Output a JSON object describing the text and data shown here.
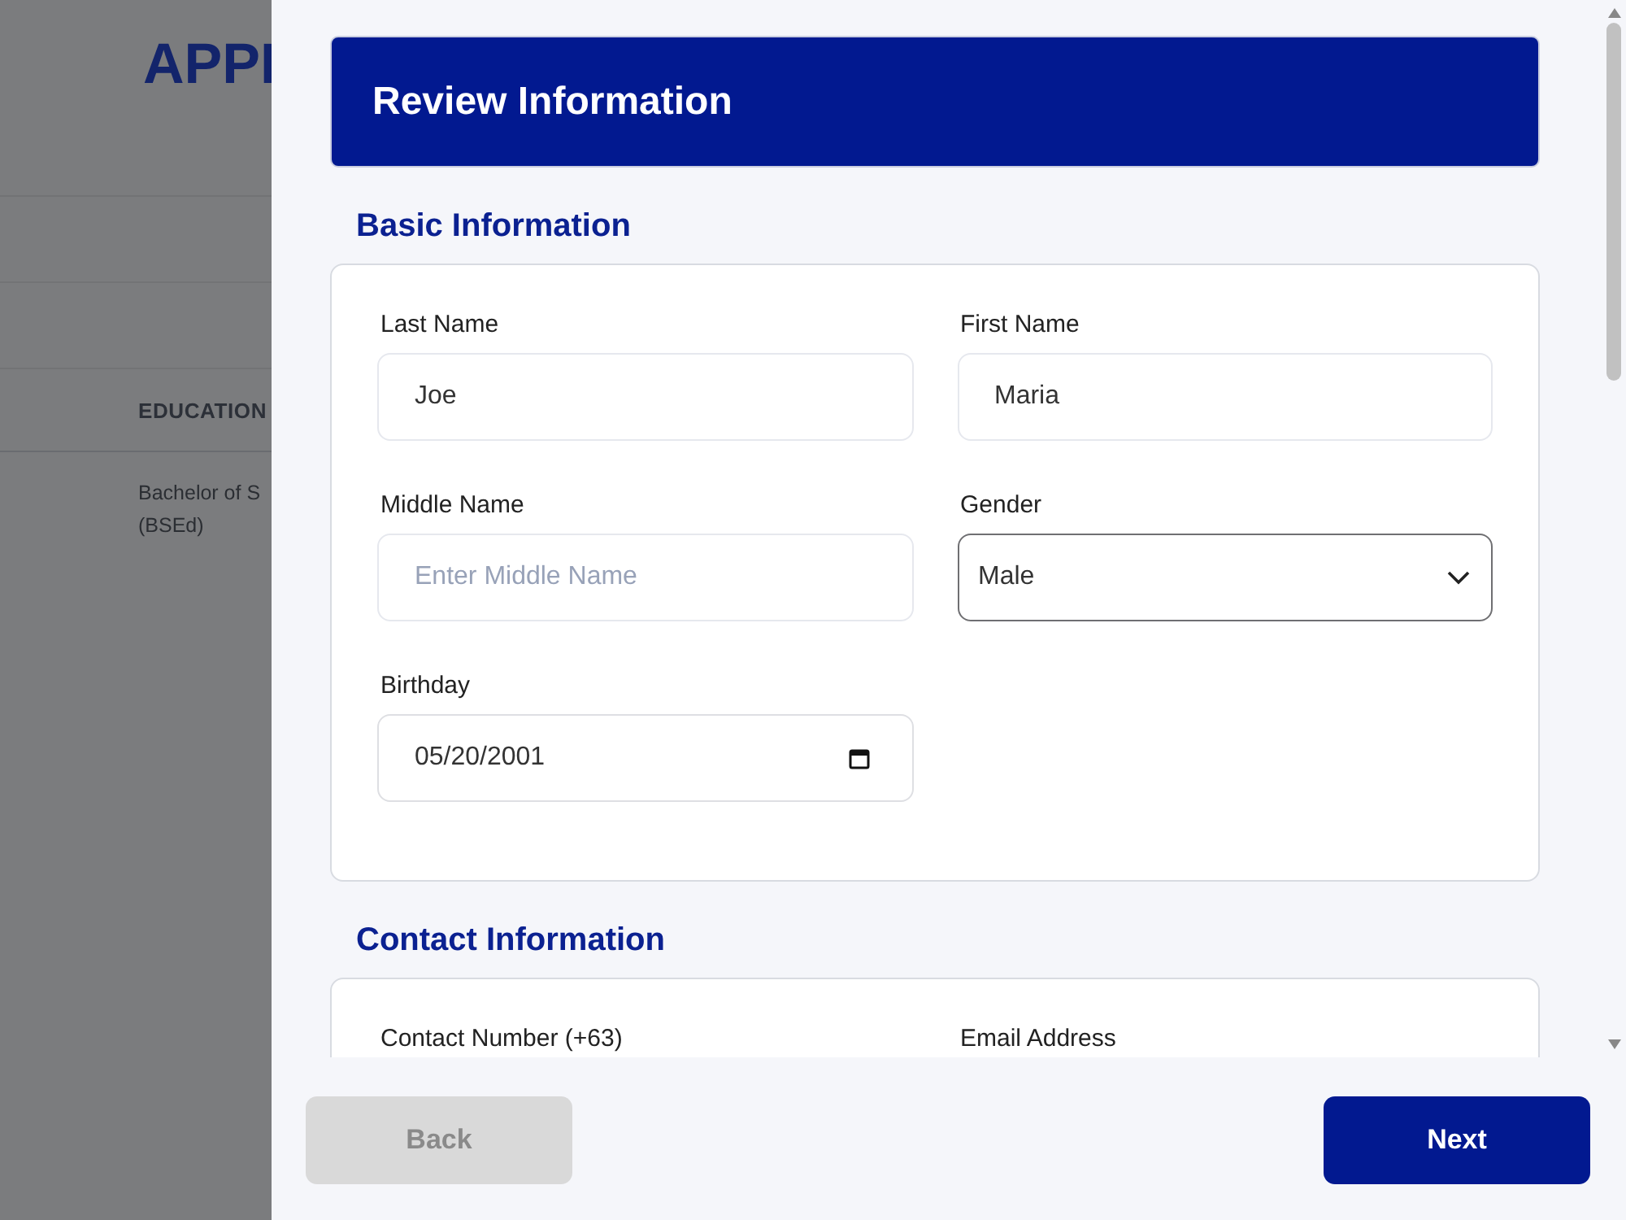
{
  "background_page": {
    "title": "APPI",
    "table": {
      "columns": [
        "EDUCATION"
      ],
      "rows": [
        [
          "Bachelor of S\n(BSEd)"
        ]
      ]
    }
  },
  "panel": {
    "title": "Review Information",
    "sections": [
      {
        "title": "Basic Information",
        "fields": [
          {
            "label": "Last Name",
            "kind": "text",
            "value": "Joe"
          },
          {
            "label": "First Name",
            "kind": "text",
            "value": "Maria"
          },
          {
            "label": "Middle Name",
            "kind": "text",
            "placeholder": "Enter Middle Name"
          },
          {
            "label": "Gender",
            "kind": "select",
            "value": "Male"
          },
          {
            "label": "Birthday",
            "kind": "date",
            "value": "05/20/2001"
          }
        ]
      },
      {
        "title": "Contact Information",
        "fields": [
          {
            "label": "Contact Number (+63)",
            "kind": "label"
          },
          {
            "label": "Email Address",
            "kind": "label"
          }
        ]
      }
    ],
    "buttons": [
      {
        "label": "Back",
        "disabled": true
      },
      {
        "label": "Next",
        "disabled": false
      }
    ]
  }
}
